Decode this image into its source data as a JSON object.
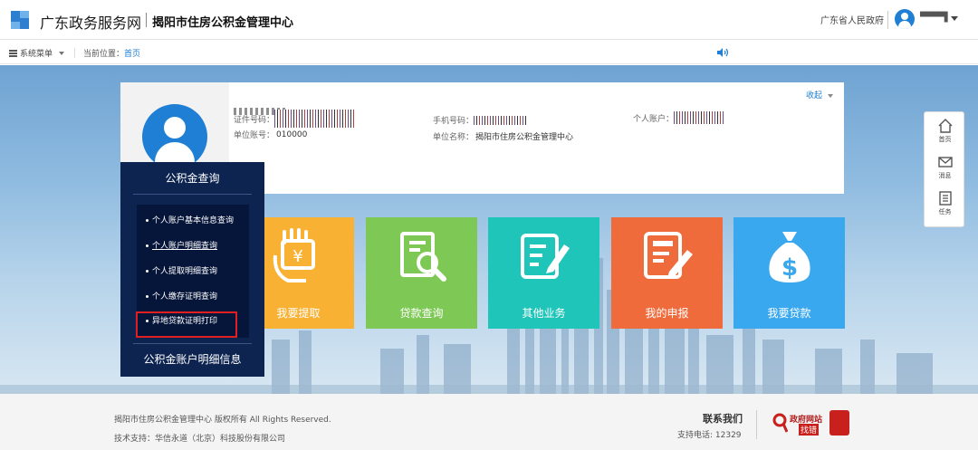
{
  "header": {
    "brand": "广东政务服务网",
    "org": "揭阳市住房公积金管理中心",
    "province_link": "广东省人民政府",
    "user_name": "▀▀▀▀▌"
  },
  "nav": {
    "menu_label": "系统菜单",
    "location_prefix": "当前位置：",
    "location_home": "首页"
  },
  "profile": {
    "collapse": "收起",
    "id_label": "证件号码：",
    "phone_label": "手机号码：",
    "account_label": "个人账户：",
    "unit_no_label": "单位账号：",
    "unit_no_value": "010000",
    "unit_name_label": "单位名称：",
    "unit_name_value": "揭阳市住房公积金管理中心"
  },
  "side_panel": {
    "title": "公积金查询",
    "items": [
      {
        "label": "个人账户基本信息查询"
      },
      {
        "label": "个人账户明细查询"
      },
      {
        "label": "个人提取明细查询"
      },
      {
        "label": "个人缴存证明查询"
      },
      {
        "label": "异地贷款证明打印"
      }
    ],
    "bottom": "公积金账户明细信息"
  },
  "tiles": [
    {
      "label": "我要提取",
      "color": "#f8b133"
    },
    {
      "label": "贷款查询",
      "color": "#7ec855"
    },
    {
      "label": "其他业务",
      "color": "#1fc5b8"
    },
    {
      "label": "我的申报",
      "color": "#ef6b3c"
    },
    {
      "label": "我要贷款",
      "color": "#3aa8ee"
    }
  ],
  "rail": {
    "home": "首页",
    "message": "消息",
    "task": "任务"
  },
  "footer": {
    "copyright": "揭阳市住房公积金管理中心 版权所有 All Rights Reserved.",
    "tech": "技术支持：华信永道（北京）科技股份有限公司",
    "contact_title": "联系我们",
    "phone": "支持电话: 12329",
    "badge_line1": "政府网站",
    "badge_line2": "找错"
  }
}
